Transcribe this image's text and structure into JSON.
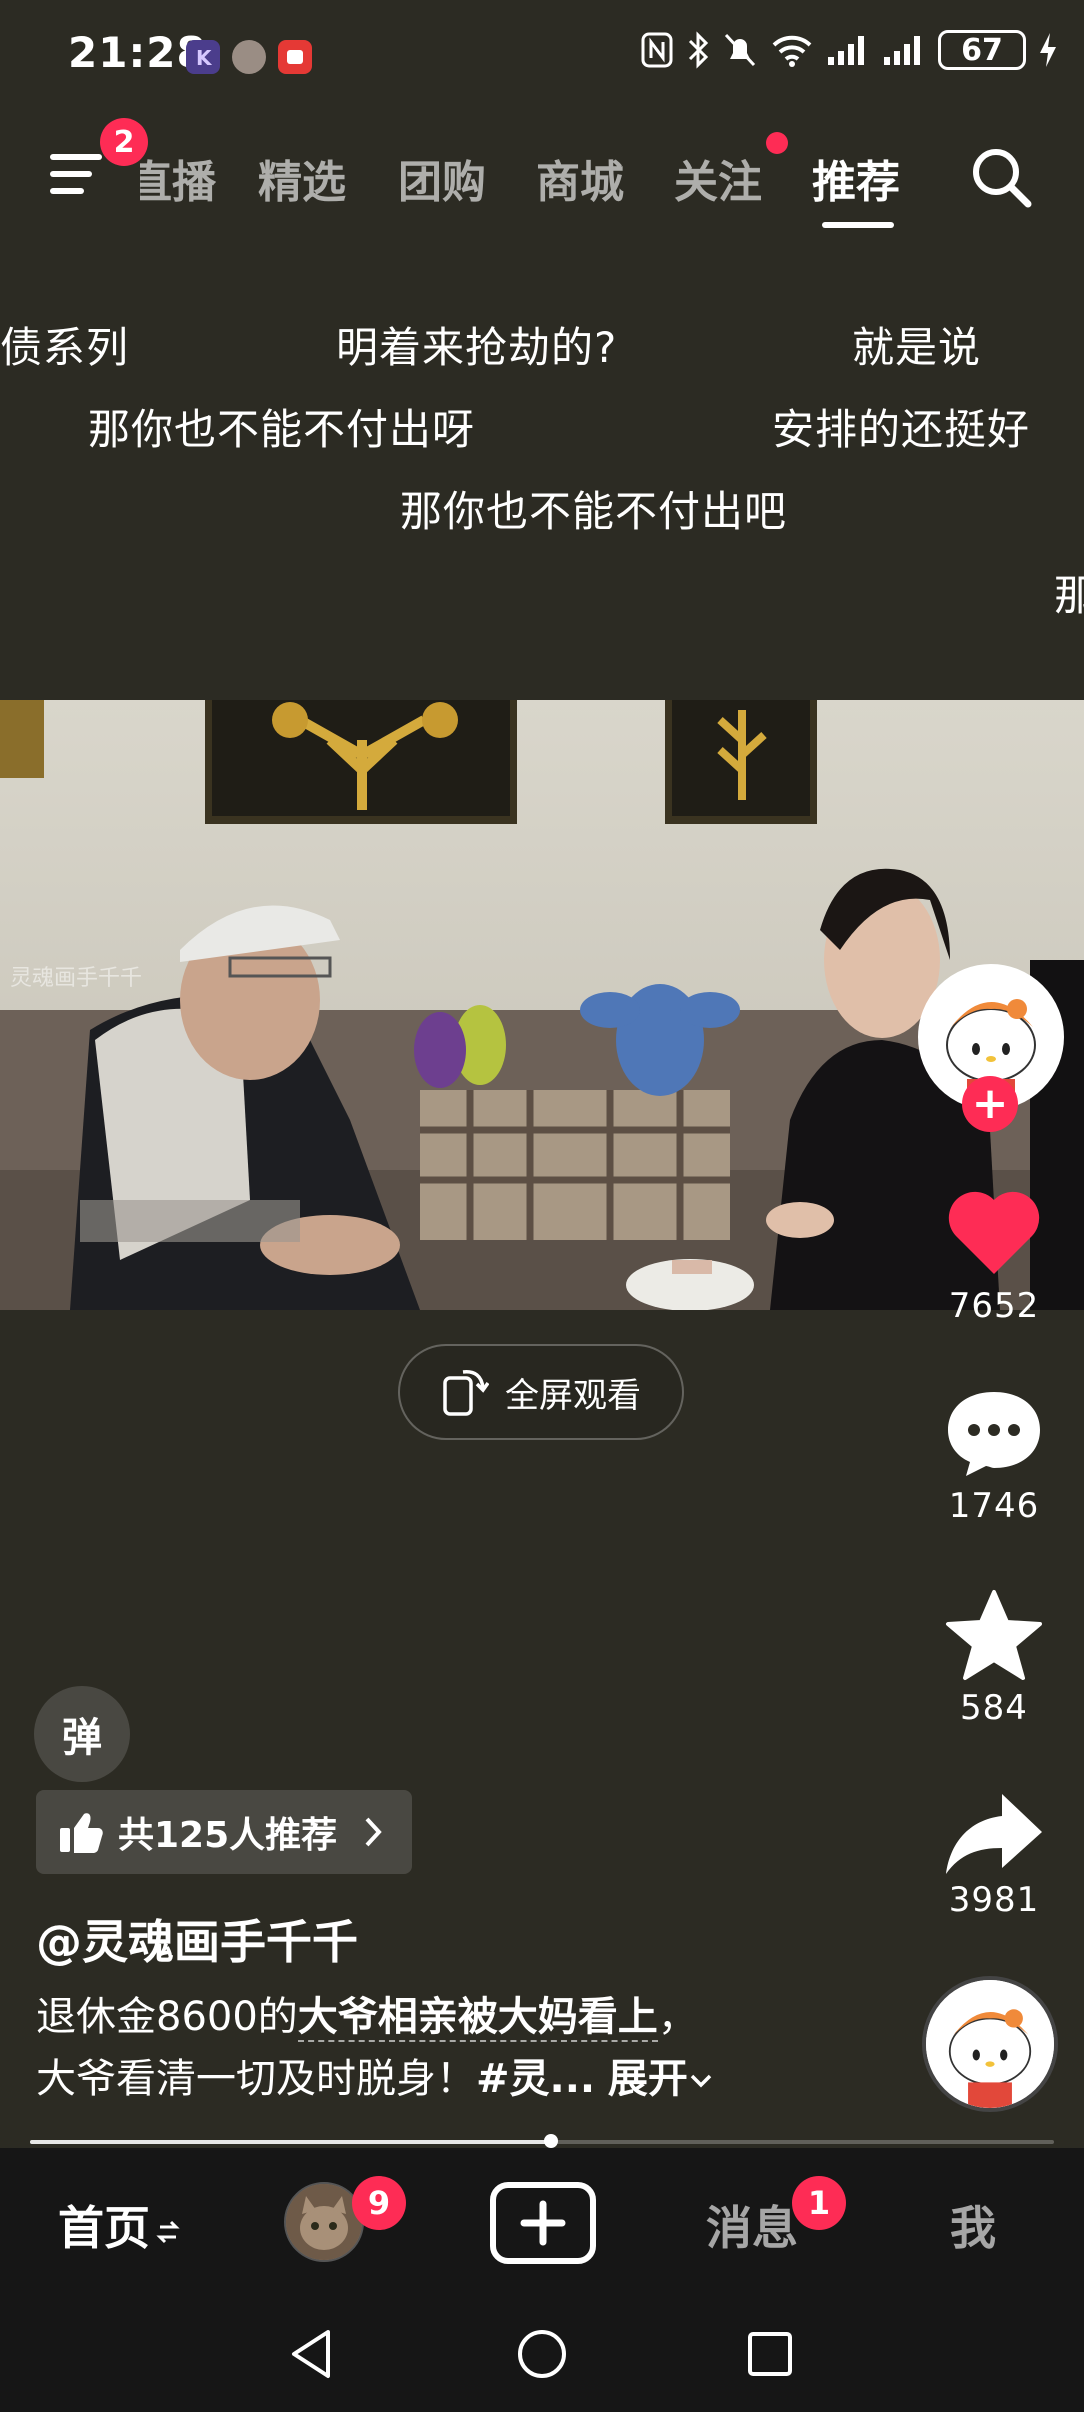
{
  "status_bar": {
    "time": "21:28",
    "battery": "67"
  },
  "top_nav": {
    "menu_badge": "2",
    "tabs": [
      {
        "label": "直播",
        "active": false
      },
      {
        "label": "精选",
        "active": false
      },
      {
        "label": "团购",
        "active": false
      },
      {
        "label": "商城",
        "active": false
      },
      {
        "label": "关注",
        "active": false
      },
      {
        "label": "推荐",
        "active": true
      }
    ],
    "search_icon": "search-icon",
    "menu_icon": "menu-icon"
  },
  "danmaku": [
    "债系列",
    "明着来抢劫的?",
    "就是说",
    "那你也不能不付出呀",
    "安排的还挺好",
    "那你也不能不付出吧",
    "那"
  ],
  "video": {
    "watermark": "灵魂画手千千",
    "fullscreen_label": "全屏观看"
  },
  "sidebar": {
    "like_count": "7652",
    "comment_count": "1746",
    "favorite_count": "584",
    "share_count": "3981",
    "follow_plus": "+"
  },
  "post": {
    "danmaku_toggle": "弹",
    "recommend_label": "共125人推荐",
    "author": "@灵魂画手千千",
    "desc_prefix": "退休金8600的",
    "desc_highlight": "大爷相亲被大妈看上",
    "desc_mid": "，",
    "desc_line2": "大爷看清一切及时脱身！",
    "desc_tag": "#灵...",
    "desc_expand": "展开",
    "progress": 0.5
  },
  "bottom_nav": {
    "home": "首页",
    "friend_badge": "9",
    "messages": "消息",
    "messages_badge": "1",
    "me": "我"
  },
  "colors": {
    "background": "#2c2b23",
    "accent": "#fe2c55",
    "nav_bg": "#161616"
  }
}
